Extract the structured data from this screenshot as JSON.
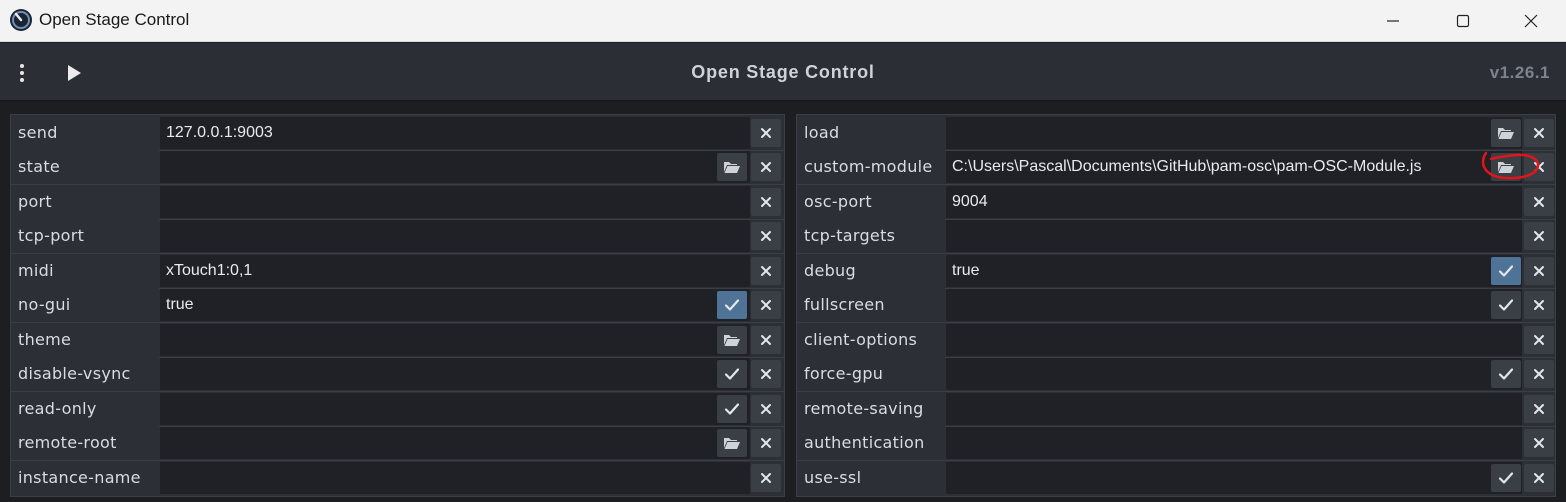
{
  "window": {
    "title": "Open Stage Control",
    "icon": "osc-knob-icon",
    "controls": [
      "minimize-icon",
      "maximize-icon",
      "close-icon"
    ]
  },
  "header": {
    "title": "Open Stage Control",
    "version": "v1.26.1",
    "menu_icon": "vertical-dots-icon",
    "play_icon": "play-icon"
  },
  "colors": {
    "header_bg": "#2b2e34",
    "panel_bg": "#2c2f35",
    "input_bg": "#1f2126",
    "button_bg": "#3a3e45",
    "button_active": "#4f7397",
    "annotation": "#e0161b"
  },
  "left_options": [
    {
      "label": "send",
      "value": "127.0.0.1:9003",
      "browse": false,
      "toggle": false,
      "toggle_on": false
    },
    {
      "label": "state",
      "value": "",
      "browse": true,
      "toggle": false,
      "toggle_on": false
    },
    {
      "label": "port",
      "value": "",
      "browse": false,
      "toggle": false,
      "toggle_on": false
    },
    {
      "label": "tcp-port",
      "value": "",
      "browse": false,
      "toggle": false,
      "toggle_on": false
    },
    {
      "label": "midi",
      "value": "xTouch1:0,1",
      "browse": false,
      "toggle": false,
      "toggle_on": false
    },
    {
      "label": "no-gui",
      "value": "true",
      "browse": false,
      "toggle": true,
      "toggle_on": true
    },
    {
      "label": "theme",
      "value": "",
      "browse": true,
      "toggle": false,
      "toggle_on": false
    },
    {
      "label": "disable-vsync",
      "value": "",
      "browse": false,
      "toggle": true,
      "toggle_on": false
    },
    {
      "label": "read-only",
      "value": "",
      "browse": false,
      "toggle": true,
      "toggle_on": false
    },
    {
      "label": "remote-root",
      "value": "",
      "browse": true,
      "toggle": false,
      "toggle_on": false
    },
    {
      "label": "instance-name",
      "value": "",
      "browse": false,
      "toggle": false,
      "toggle_on": false
    }
  ],
  "right_options": [
    {
      "label": "load",
      "value": "",
      "browse": true,
      "toggle": false,
      "toggle_on": false
    },
    {
      "label": "custom-module",
      "value": "C:\\Users\\Pascal\\Documents\\GitHub\\pam-osc\\pam-OSC-Module.js",
      "browse": true,
      "toggle": false,
      "toggle_on": false
    },
    {
      "label": "osc-port",
      "value": "9004",
      "browse": false,
      "toggle": false,
      "toggle_on": false
    },
    {
      "label": "tcp-targets",
      "value": "",
      "browse": false,
      "toggle": false,
      "toggle_on": false
    },
    {
      "label": "debug",
      "value": "true",
      "browse": false,
      "toggle": true,
      "toggle_on": true
    },
    {
      "label": "fullscreen",
      "value": "",
      "browse": false,
      "toggle": true,
      "toggle_on": false
    },
    {
      "label": "client-options",
      "value": "",
      "browse": false,
      "toggle": false,
      "toggle_on": false
    },
    {
      "label": "force-gpu",
      "value": "",
      "browse": false,
      "toggle": true,
      "toggle_on": false
    },
    {
      "label": "remote-saving",
      "value": "",
      "browse": false,
      "toggle": false,
      "toggle_on": false
    },
    {
      "label": "authentication",
      "value": "",
      "browse": false,
      "toggle": false,
      "toggle_on": false
    },
    {
      "label": "use-ssl",
      "value": "",
      "browse": false,
      "toggle": true,
      "toggle_on": false
    }
  ]
}
